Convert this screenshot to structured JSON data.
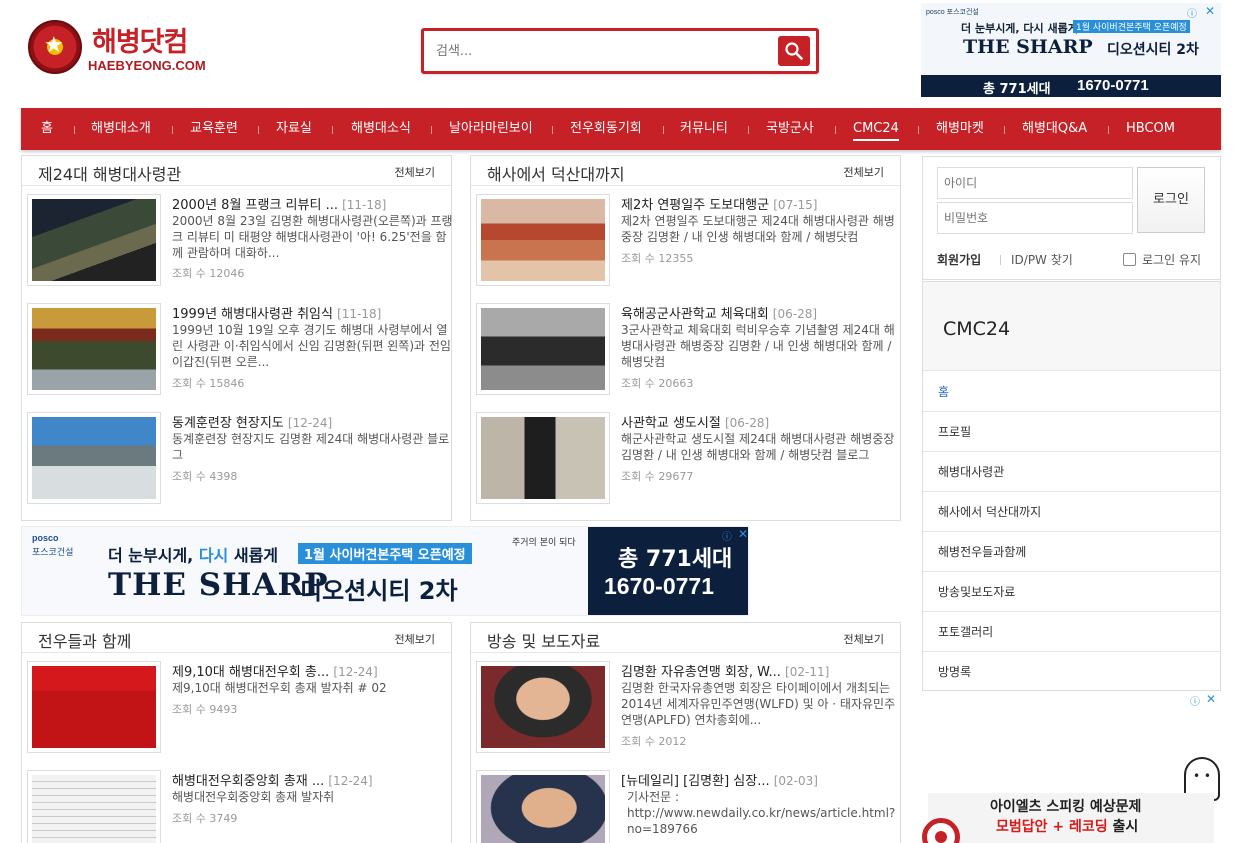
{
  "logo": {
    "kr": "해병닷컴",
    "en": "HAEBYEONG.COM"
  },
  "search": {
    "placeholder": "검색..."
  },
  "top_ad": {
    "posco": "posco 포스코건설",
    "line1": "더 눈부시게, 다시 새롭게",
    "tag": "1월 사이버견본주택 오픈예정",
    "brand": "THE SHARP",
    "city": "디오션시티 2차",
    "units": "총 771세대",
    "phone": "1670-0771"
  },
  "nav": [
    "홈",
    "해병대소개",
    "교육훈련",
    "자료실",
    "해병대소식",
    "날아라마린보이",
    "전우회동기회",
    "커뮤니티",
    "국방군사",
    "CMC24",
    "해병마켓",
    "해병대Q&A",
    "HBCOM"
  ],
  "more_label": "전체보기",
  "panels": {
    "p1": {
      "title": "제24대 해병대사령관",
      "items": [
        {
          "title": "2000년 8월 프랭크 리뷰티 ...",
          "date": "[11-18]",
          "desc": "2000년 8월 23일 김명환 해병대사령관(오른쪽)과 프랭크 리뷰티 미 태평양 해병대사령관이 '아! 6.25'전을 함께 관람하며 대화하...",
          "views": "조회 수 12046"
        },
        {
          "title": "1999년 해병대사령관 취임식",
          "date": "[11-18]",
          "desc": "1999년 10월 19일 오후 경기도 해병대 사령부에서 열린 사령관 이·취임식에서 신임 김명환(뒤편 왼쪽)과 전임 이갑진(뒤편 오른...",
          "views": "조회 수 15846"
        },
        {
          "title": "동계훈련장 현장지도",
          "date": "[12-24]",
          "desc": "동계훈련장 현장지도 김명환 제24대 해병대사령관 블로그",
          "views": "조회 수 4398"
        }
      ]
    },
    "p2": {
      "title": "해사에서 덕산대까지",
      "items": [
        {
          "title": "제2차 연평일주 도보대행군",
          "date": "[07-15]",
          "desc": "제2차 연평일주 도보대행군 제24대 해병대사령관 해병중장 김명환 / 내 인생 해병대와 함께 / 해병닷컴",
          "views": "조회 수 12355"
        },
        {
          "title": "육해공군사관학교 체육대회",
          "date": "[06-28]",
          "desc": "3군사관학교 체육대회 럭비우승후 기념촬영 제24대 해병대사령관 해병중장 김명환 / 내 인생 해병대와 함께 / 해병닷컴",
          "views": "조회 수 20663"
        },
        {
          "title": "사관학교 생도시절",
          "date": "[06-28]",
          "desc": "해군사관학교 생도시절 제24대 해병대사령관 해병중장 김명환 / 내 인생 해병대와 함께 / 해병닷컴 블로그",
          "views": "조회 수 29677"
        }
      ]
    },
    "p3": {
      "title": "전우들과 함께",
      "items": [
        {
          "title": "제9,10대 해병대전우회 총...",
          "date": "[12-24]",
          "desc": "제9,10대 해병대전우회 총재 발자취 # 02",
          "views": "조회 수 9493"
        },
        {
          "title": "해병대전우회중앙회 총재 ...",
          "date": "[12-24]",
          "desc": "해병대전우회중앙회 총재 발자취",
          "views": "조회 수 3749"
        }
      ]
    },
    "p4": {
      "title": "방송 및 보도자료",
      "items": [
        {
          "title": "김명환 자유총연맹 회장, W...",
          "date": "[02-11]",
          "desc": "김명환 한국자유총연맹 회장은 타이페이에서 개최되는 2014년 세계자유민주연맹(WLFD) 및 아 · 태자유민주연맹(APLFD) 연차총회에...",
          "views": "조회 수 2012"
        },
        {
          "title": "[뉴데일리] [김명환] 심장...",
          "date": "[02-03]",
          "desc": "기사전문 : http://www.newdaily.co.kr/news/article.html?no=189766",
          "views": ""
        }
      ]
    }
  },
  "mid_ad": {
    "posco": "posco",
    "posco2": "포스코건설",
    "l1_a": "더 눈부시게, ",
    "l1_b": "다시",
    "l1_c": " 새롭게",
    "tag": "1월 사이버견본주택 오픈예정",
    "note": "주거의 본이 되다",
    "brand": "THE SHARP",
    "city": "디오션시티 2차",
    "units": "총 771세대",
    "phone": "1670-0771"
  },
  "login": {
    "id_placeholder": "아이디",
    "pw_placeholder": "비밀번호",
    "button": "로그인",
    "join": "회원가입",
    "find": "ID/PW 찾기",
    "keep": "로그인 유지"
  },
  "side_menu": {
    "title": "CMC24",
    "items": [
      "홈",
      "프로필",
      "해병대사령관",
      "해사에서 덕산대까지",
      "해병전우들과함께",
      "방송및보도자료",
      "포토갤러리",
      "방명록"
    ]
  },
  "side_ad": {
    "t1": "아이엘츠 스피킹 예상문제",
    "t2_a": "모범답안 + 레코딩",
    "t2_b": " 출시"
  },
  "colors": {
    "brand_red": "#c62127",
    "link_blue": "#2a6fc9",
    "ad_navy": "#0c1f3d"
  }
}
